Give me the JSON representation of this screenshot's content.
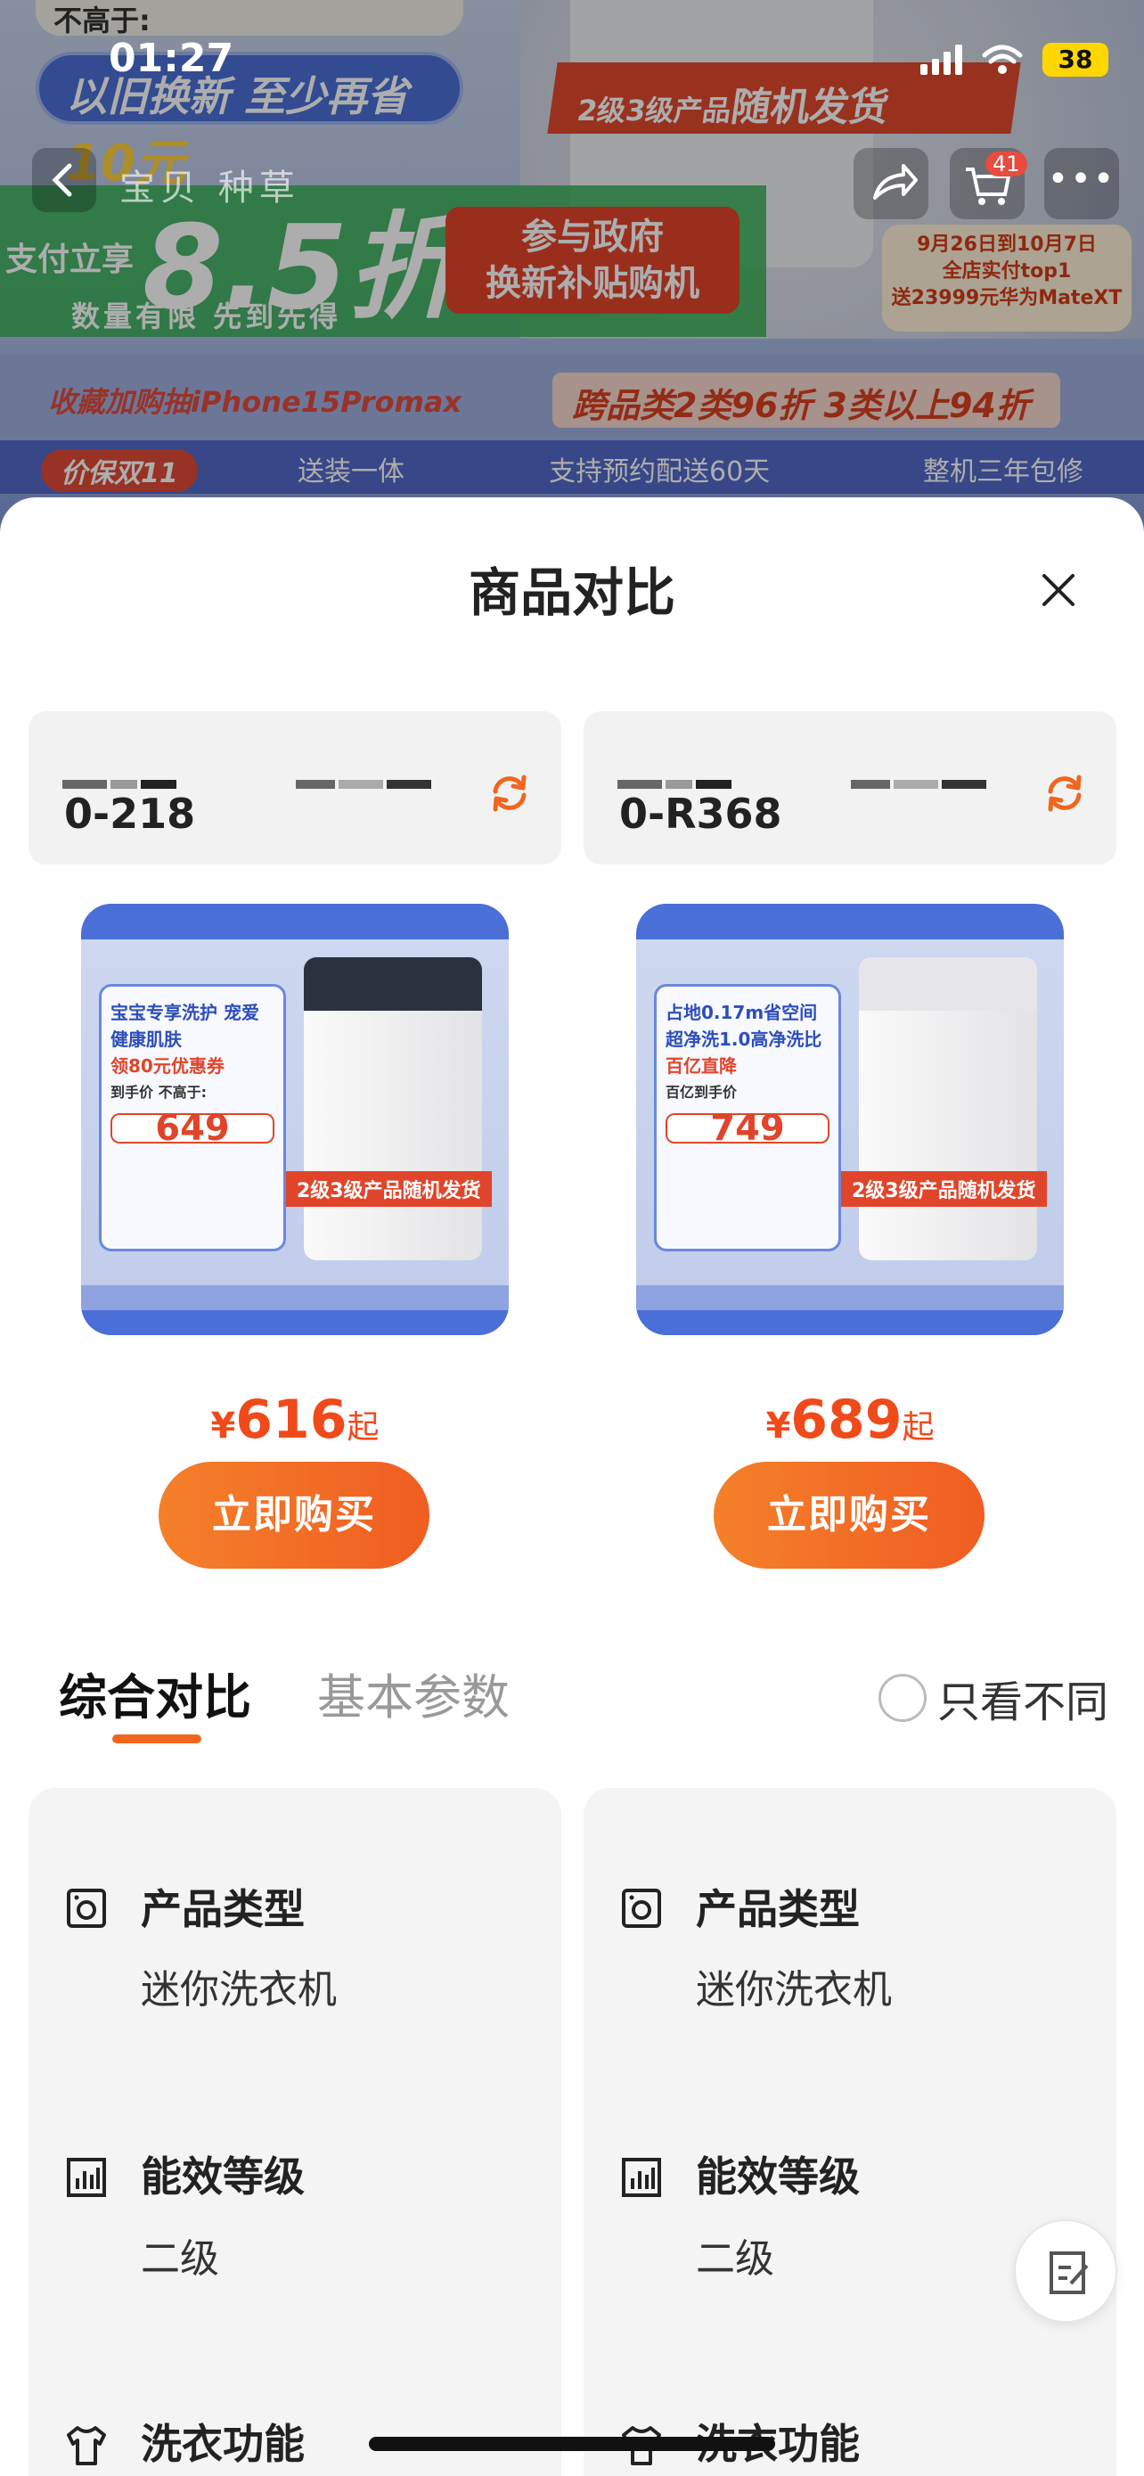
{
  "status_bar": {
    "time": "01:27",
    "battery": "38"
  },
  "banner": {
    "top_text": "不高于:",
    "trade_in": "以旧换新 至少再省",
    "trade_in_amount": "10元",
    "random_ship_prefix": "2级3级产品",
    "random_ship": "随机发货",
    "pay_now": "支付立享",
    "discount": "8.5折",
    "limited": "数量有限 先到先得",
    "gov_line1": "参与政府",
    "gov_line2": "换新补贴购机",
    "date_promo_1": "9月26日到10月7日",
    "date_promo_2": "全店实付top1",
    "date_promo_3": "送23999元华为MateXT",
    "collect_draw": "收藏加购抽iPhone15Promax",
    "cross_category": "跨品类2类96折 3类以上94折",
    "features": [
      "价保双11",
      "送装一体",
      "支持预约配送60天",
      "整机三年包修"
    ]
  },
  "nav": {
    "tabs": "宝贝 种草",
    "cart_count": "41"
  },
  "sheet": {
    "title": "商品对比",
    "products": [
      {
        "model": "0-218",
        "image": {
          "box_title": "宝宝专享洗护 宠爱健康肌肤",
          "coupon": "领80元优惠券",
          "price_label": "到手价 不高于:",
          "price": "649",
          "tag": "2级3级产品随机发货"
        },
        "currency": "¥",
        "price": "616",
        "price_suffix": "起",
        "buy_label": "立即购买"
      },
      {
        "model": "0-R368",
        "image": {
          "box_title": "占地0.17m省空间 超净洗1.0高净洗比",
          "coupon": "百亿直降",
          "price_label": "百亿到手价",
          "price": "749",
          "tag": "2级3级产品随机发货"
        },
        "currency": "¥",
        "price": "689",
        "price_suffix": "起",
        "buy_label": "立即购买"
      }
    ],
    "tabs": {
      "active": "综合对比",
      "inactive": "基本参数"
    },
    "only_diff": "只看不同",
    "rows": [
      {
        "label": "产品类型",
        "values": [
          "迷你洗衣机",
          "迷你洗衣机"
        ],
        "icon": "washer-icon"
      },
      {
        "label": "能效等级",
        "values": [
          "二级",
          "二级"
        ],
        "icon": "bar-chart-icon"
      },
      {
        "label": "洗衣功能",
        "values": [
          "",
          ""
        ],
        "icon": "shirt-icon"
      }
    ]
  },
  "colors": {
    "accent": "#f05d22",
    "price": "#f04a1b",
    "card_bg": "#f4f4f4"
  }
}
